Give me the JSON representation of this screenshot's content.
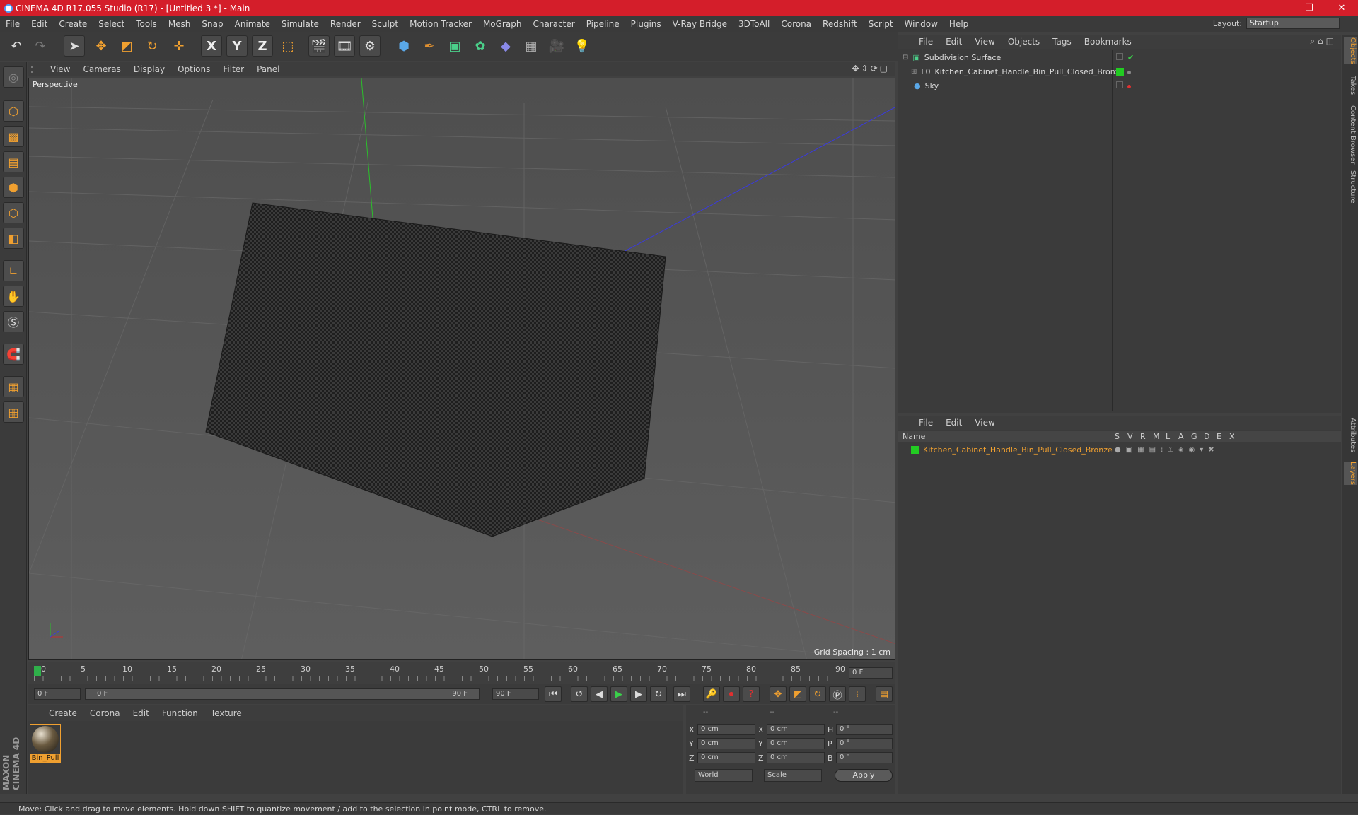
{
  "window": {
    "title": "CINEMA 4D R17.055 Studio (R17) - [Untitled 3 *] - Main",
    "minimize": "—",
    "maximize": "❐",
    "close": "✕"
  },
  "menubar": {
    "items": [
      "File",
      "Edit",
      "Create",
      "Select",
      "Tools",
      "Mesh",
      "Snap",
      "Animate",
      "Simulate",
      "Render",
      "Sculpt",
      "Motion Tracker",
      "MoGraph",
      "Character",
      "Pipeline",
      "Plugins",
      "V-Ray Bridge",
      "3DToAll",
      "Corona",
      "Redshift",
      "Script",
      "Window",
      "Help"
    ],
    "layout_label": "Layout:",
    "layout_value": "Startup"
  },
  "toolbar": {
    "x_label": "X",
    "y_label": "Y",
    "z_label": "Z"
  },
  "viewport": {
    "menu": [
      "View",
      "Cameras",
      "Display",
      "Options",
      "Filter",
      "Panel"
    ],
    "label": "Perspective",
    "grid_spacing": "Grid Spacing : 1 cm"
  },
  "timeline": {
    "ticks": [
      "0",
      "5",
      "10",
      "15",
      "20",
      "25",
      "30",
      "35",
      "40",
      "45",
      "50",
      "55",
      "60",
      "65",
      "70",
      "75",
      "80",
      "85",
      "90"
    ],
    "current_frame": "0 F",
    "start_field": "0 F",
    "range_start": "0 F",
    "range_end": "90 F",
    "end_field": "90 F"
  },
  "material_manager": {
    "menu": [
      "Create",
      "Corona",
      "Edit",
      "Function",
      "Texture"
    ],
    "material_name": "Bin_Pull"
  },
  "coordinates": {
    "header": [
      "--",
      "--",
      "--"
    ],
    "rows": [
      {
        "axis": "X",
        "pos": "0 cm",
        "axis2": "X",
        "size": "0 cm",
        "axis3": "H",
        "rot": "0 °"
      },
      {
        "axis": "Y",
        "pos": "0 cm",
        "axis2": "Y",
        "size": "0 cm",
        "axis3": "P",
        "rot": "0 °"
      },
      {
        "axis": "Z",
        "pos": "0 cm",
        "axis2": "Z",
        "size": "0 cm",
        "axis3": "B",
        "rot": "0 °"
      }
    ],
    "world": "World",
    "scale": "Scale",
    "apply": "Apply"
  },
  "object_manager": {
    "menu": [
      "File",
      "Edit",
      "View",
      "Objects",
      "Tags",
      "Bookmarks"
    ],
    "objects": [
      {
        "name": "Subdivision Surface"
      },
      {
        "name": "Kitchen_Cabinet_Handle_Bin_Pull_Closed_Bronze"
      },
      {
        "name": "Sky"
      }
    ]
  },
  "layer_manager": {
    "menu": [
      "File",
      "Edit",
      "View"
    ],
    "columns": [
      "Name",
      "S",
      "V",
      "R",
      "M",
      "L",
      "A",
      "G",
      "D",
      "E",
      "X"
    ],
    "layers": [
      {
        "name": "Kitchen_Cabinet_Handle_Bin_Pull_Closed_Bronze"
      }
    ]
  },
  "right_tabs": [
    "Objects",
    "Takes",
    "Content Browser",
    "Structure",
    "Attributes",
    "Layers"
  ],
  "brand": "MAXON CINEMA 4D",
  "status": "Move: Click and drag to move elements. Hold down SHIFT to quantize movement / add to the selection in point mode, CTRL to remove.",
  "colors": {
    "title_bar": "#d41e2a",
    "accent": "#f0a030",
    "layer_green": "#22cc22",
    "layer_name": "#f0a030"
  }
}
